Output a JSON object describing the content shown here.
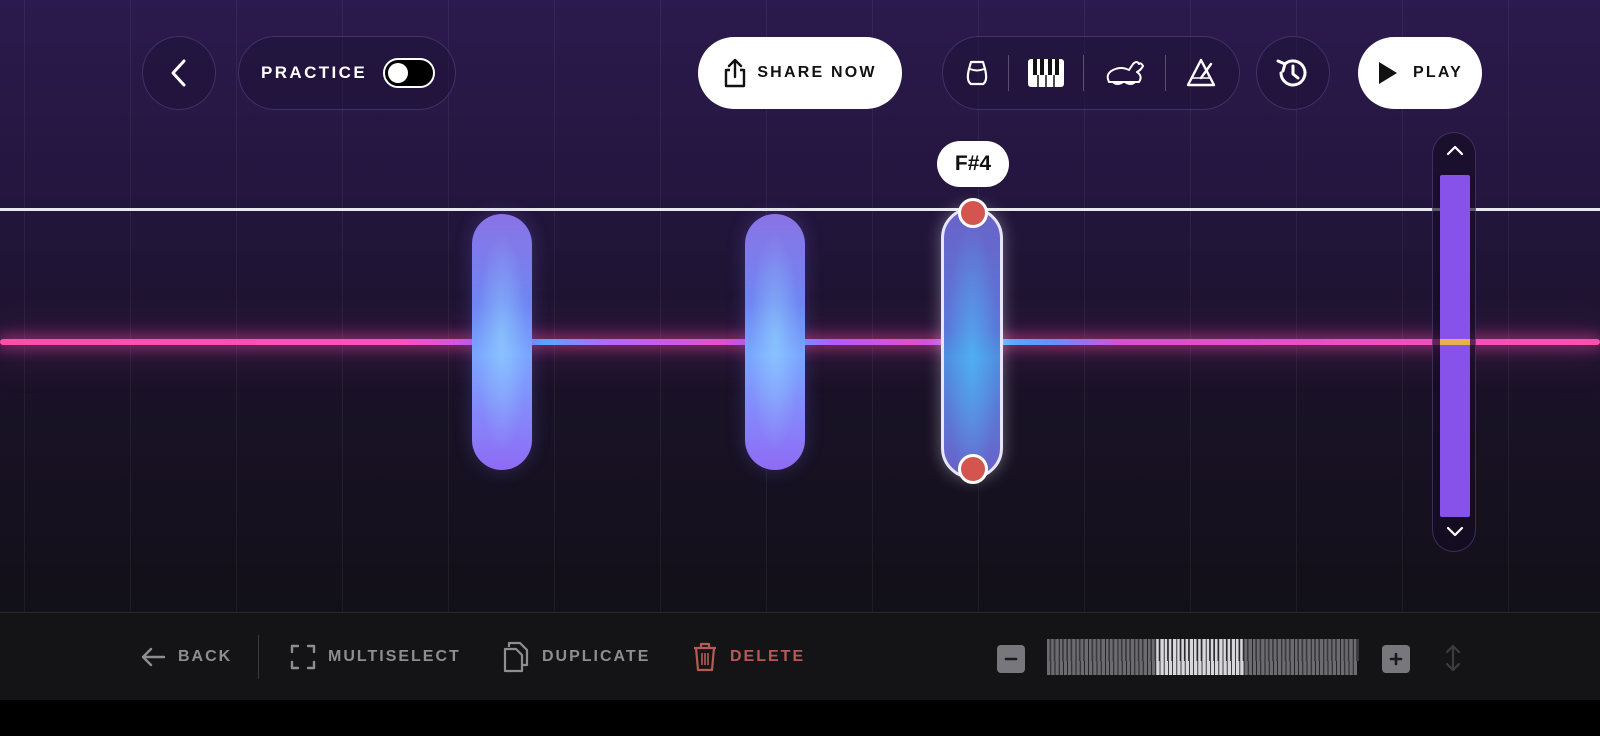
{
  "header": {
    "practice_label": "PRACTICE",
    "practice_toggle_on": false,
    "share_label": "SHARE NOW",
    "play_label": "PLAY",
    "tools": [
      "bell-icon",
      "piano-keys-icon",
      "rabbit-icon",
      "metronome-icon"
    ]
  },
  "editor": {
    "selected_note_label": "F#4",
    "accent_color": "#8652ea",
    "handle_color": "#d4544f",
    "pitch_line_color": "#ff4fa8"
  },
  "bottom_toolbar": {
    "back_label": "BACK",
    "multiselect_label": "MULTISELECT",
    "duplicate_label": "DUPLICATE",
    "delete_label": "DELETE",
    "delete_color": "#b65a55"
  }
}
